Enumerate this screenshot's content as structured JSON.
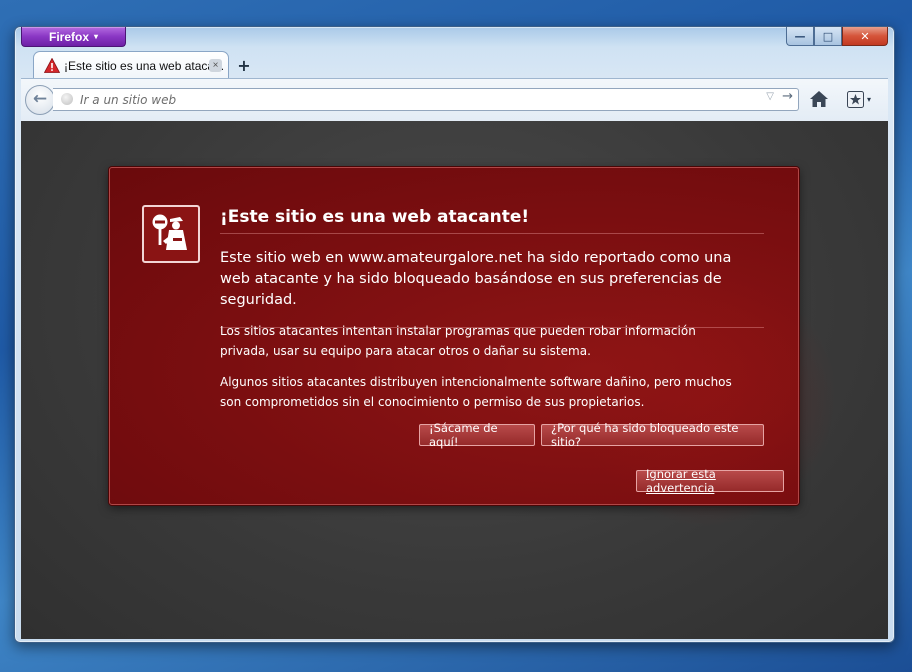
{
  "browser": {
    "menu_label": "Firefox",
    "menu_arrow": "▾",
    "window_controls": {
      "minimize": "—",
      "maximize": "□",
      "close": "✕"
    }
  },
  "tab": {
    "title": "¡Este sitio es una web ataca...",
    "icon": "warning-triangle-icon",
    "close_label": "×",
    "new_tab_label": "+"
  },
  "navbar": {
    "back_label": "←",
    "url_placeholder": "Ir a un sitio web",
    "url_value": "",
    "dropmarker": "▽",
    "go_label": "→",
    "home_icon": "home-icon",
    "bookmark_icon": "bookmark-star-icon",
    "bookmark_caret": "▾"
  },
  "error_page": {
    "title": "¡Este sitio es una web atacante!",
    "short_desc": "Este sitio web en www.amateurgalore.net ha sido reportado como una web atacante y ha sido bloqueado basándose en sus preferencias de seguridad.",
    "long_desc_1": "Los sitios atacantes intentan instalar programas que pueden robar información privada, usar su equipo para atacar otros o dañar su sistema.",
    "long_desc_2": "Algunos sitios atacantes distribuyen intencionalmente software dañino, pero muchos son comprometidos sin el conocimiento o permiso de sus propietarios.",
    "buttons": {
      "get_me_out": "¡Sácame de aquí!",
      "why_blocked": "¿Por qué ha sido bloqueado este sitio?",
      "ignore": "Ignorar esta advertencia"
    }
  },
  "colors": {
    "firefox_button": "#8a37c4",
    "error_bg": "#7a0e10",
    "content_bg": "#393939",
    "close_button": "#d5543a"
  }
}
